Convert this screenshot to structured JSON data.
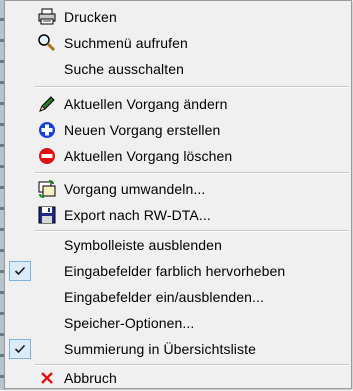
{
  "menu": {
    "items": [
      {
        "label": "Drucken",
        "icon": "printer-icon"
      },
      {
        "label": "Suchmenü aufrufen",
        "icon": "magnifier-icon"
      },
      {
        "label": "Suche ausschalten",
        "icon": null
      },
      {
        "label": "Aktuellen Vorgang ändern",
        "icon": "pen-icon"
      },
      {
        "label": "Neuen Vorgang erstellen",
        "icon": "add-circle-icon",
        "color": "#1a3fd6"
      },
      {
        "label": "Aktuellen Vorgang löschen",
        "icon": "remove-circle-icon",
        "color": "#e01010"
      },
      {
        "label": "Vorgang umwandeln...",
        "icon": "convert-icon"
      },
      {
        "label": "Export nach RW-DTA...",
        "icon": "floppy-disk-icon"
      },
      {
        "label": "Symbolleiste ausblenden",
        "icon": null
      },
      {
        "label": "Eingabefelder farblich hervorheben",
        "icon": null,
        "checked": true
      },
      {
        "label": "Eingabefelder ein/ausblenden...",
        "icon": null
      },
      {
        "label": "Speicher-Optionen...",
        "icon": null
      },
      {
        "label": "Summierung in Übersichtsliste",
        "icon": null,
        "checked": true
      },
      {
        "label": "Abbruch",
        "icon": "cancel-x-icon",
        "color": "#e01010"
      }
    ]
  }
}
